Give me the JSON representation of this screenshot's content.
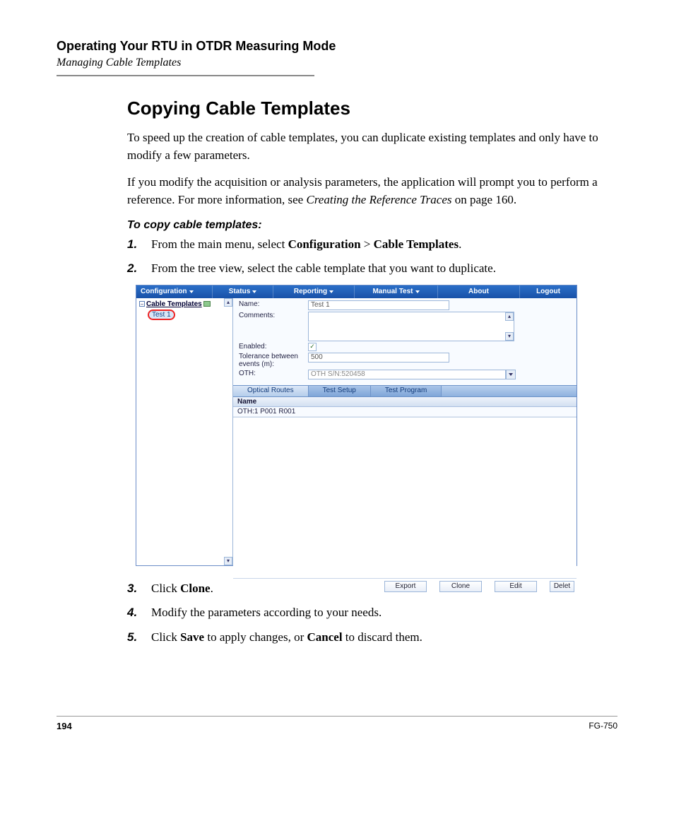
{
  "header": {
    "chapter": "Operating Your RTU in OTDR Measuring Mode",
    "section": "Managing Cable Templates"
  },
  "heading": "Copying Cable Templates",
  "para1": "To speed up the creation of cable templates, you can duplicate existing templates and only have to modify a few parameters.",
  "para2_a": "If you modify the acquisition or analysis parameters, the application will prompt you to perform a reference. For more information, see ",
  "para2_ref": "Creating the Reference Traces",
  "para2_b": " on page 160.",
  "procedure_title": "To copy cable templates:",
  "steps": {
    "s1_a": "From the main menu, select ",
    "s1_b": "Configuration",
    "s1_c": " > ",
    "s1_d": "Cable Templates",
    "s1_e": ".",
    "s2": "From the tree view, select the cable template that you want to duplicate.",
    "s3_a": "Click ",
    "s3_b": "Clone",
    "s3_c": ".",
    "s4": "Modify the parameters according to your needs.",
    "s5_a": "Click ",
    "s5_b": "Save",
    "s5_c": " to apply changes, or ",
    "s5_d": "Cancel",
    "s5_e": " to discard them."
  },
  "step_nums": {
    "n1": "1.",
    "n2": "2.",
    "n3": "3.",
    "n4": "4.",
    "n5": "5."
  },
  "app": {
    "menu": {
      "configuration": "Configuration",
      "status": "Status",
      "reporting": "Reporting",
      "manual_test": "Manual Test",
      "about": "About",
      "logout": "Logout"
    },
    "tree": {
      "toggle": "−",
      "root": "Cable Templates",
      "child": "Test 1"
    },
    "form": {
      "name_lbl": "Name:",
      "name_val": "Test 1",
      "comments_lbl": "Comments:",
      "enabled_lbl": "Enabled:",
      "tolerance_lbl": "Tolerance between events (m):",
      "tolerance_val": "500",
      "oth_lbl": "OTH:",
      "oth_val": "OTH S/N:520458"
    },
    "tabs": {
      "optical_routes": "Optical Routes",
      "test_setup": "Test Setup",
      "test_program": "Test Program"
    },
    "table": {
      "col_name": "Name",
      "row1": "OTH:1 P001 R001"
    },
    "buttons": {
      "export": "Export",
      "clone": "Clone",
      "edit": "Edit",
      "delete": "Delet"
    }
  },
  "footer": {
    "page": "194",
    "doc": "FG-750"
  }
}
